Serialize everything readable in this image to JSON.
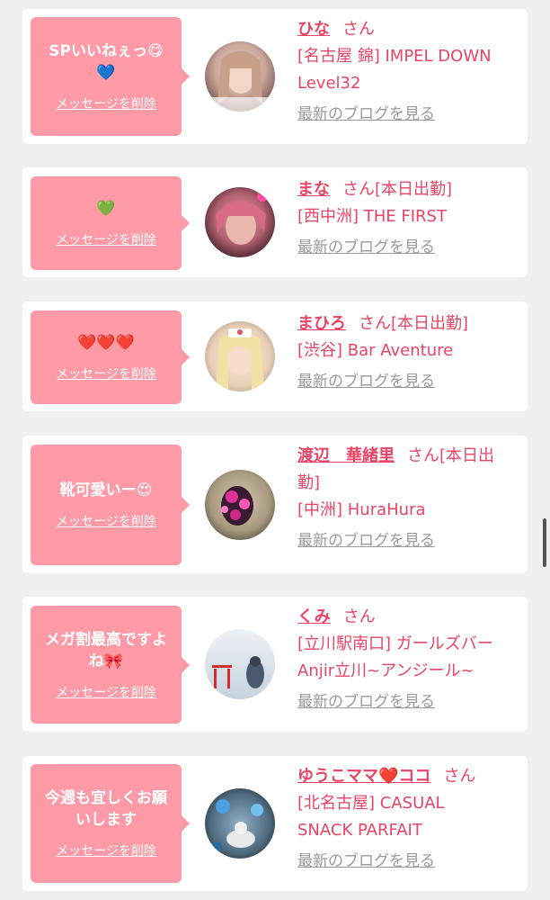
{
  "blog_link_label": "最新のブログを見る",
  "delete_label": "メッセージを削除",
  "san_label": "さん",
  "cards": [
    {
      "message": "SPいいねぇっ😋💙",
      "name": "ひな",
      "status": "",
      "shop_line1": "[名古屋 錦] IMPEL DOWN",
      "shop_line2": "Level32"
    },
    {
      "message": "💚",
      "name": "まな",
      "status": "[本日出勤]",
      "shop_line1": "[西中洲] THE FIRST",
      "shop_line2": ""
    },
    {
      "message": "❤️❤️❤️",
      "name": "まひろ",
      "status": "[本日出勤]",
      "shop_line1": "[渋谷] Bar Aventure",
      "shop_line2": ""
    },
    {
      "message": "靴可愛いー😍",
      "name": "渡辺　華緒里",
      "status": "[本日出",
      "status_cont": "勤]",
      "shop_line1": "[中洲] HuraHura",
      "shop_line2": ""
    },
    {
      "message": "メガ割最高ですよね🎀",
      "name": "くみ",
      "status": "",
      "shop_line1": "[立川駅南口] ガールズバー",
      "shop_line2": "Anjir立川~アンジール~"
    },
    {
      "message": "今週も宜しくお願いします",
      "name": "ゆうこママ❤️ココ",
      "status": "",
      "shop_line1": "[北名古屋] CASUAL",
      "shop_line2": "SNACK PARFAIT"
    }
  ]
}
